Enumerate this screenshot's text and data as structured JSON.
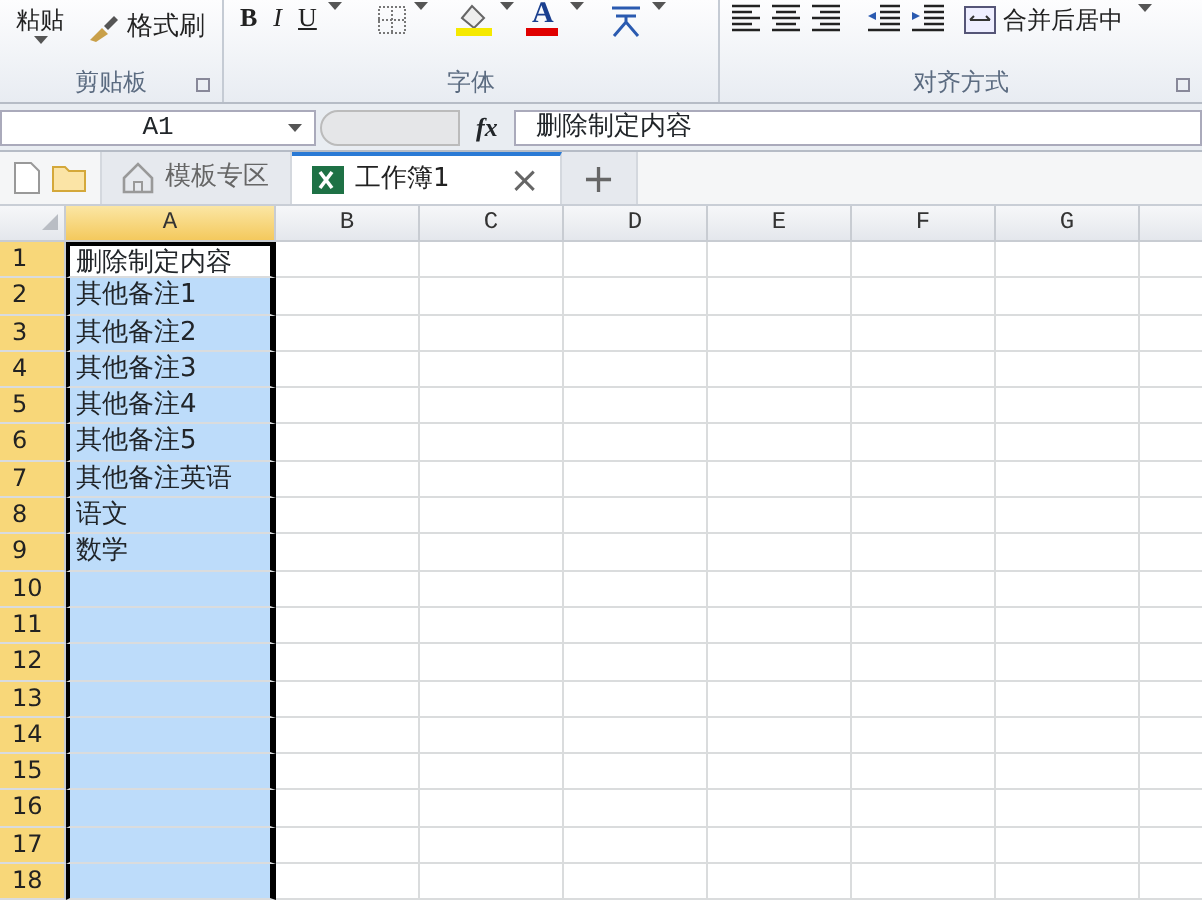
{
  "ribbon": {
    "groups": [
      {
        "kind": "clipboard",
        "label": "剪贴板",
        "paste": "粘贴",
        "format_painter": "格式刷"
      },
      {
        "kind": "font",
        "label": "字体",
        "bold": "B",
        "italic": "I",
        "underline": "U",
        "font_color": "A"
      },
      {
        "kind": "align",
        "label": "对齐方式",
        "merge": "合并后居中"
      }
    ]
  },
  "formula_bar": {
    "name_box": "A1",
    "fx": "fx",
    "value": "删除制定内容"
  },
  "tabs": [
    {
      "label": "模板专区",
      "selected": false,
      "kind": "template"
    },
    {
      "label": "工作簿1",
      "selected": true,
      "kind": "workbook",
      "close": "×"
    }
  ],
  "new_tab": "+",
  "sheet": {
    "columns": [
      {
        "label": "A",
        "selected": true
      },
      {
        "label": "B",
        "selected": false
      },
      {
        "label": "C",
        "selected": false
      },
      {
        "label": "D",
        "selected": false
      },
      {
        "label": "E",
        "selected": false
      },
      {
        "label": "F",
        "selected": false
      },
      {
        "label": "G",
        "selected": false
      }
    ],
    "rows": [
      {
        "number": "1",
        "selected": true,
        "active": true,
        "cells": [
          "删除制定内容"
        ]
      },
      {
        "number": "2",
        "selected": true,
        "cells": [
          "其他备注1"
        ]
      },
      {
        "number": "3",
        "selected": true,
        "cells": [
          "其他备注2"
        ]
      },
      {
        "number": "4",
        "selected": true,
        "cells": [
          "其他备注3"
        ]
      },
      {
        "number": "5",
        "selected": true,
        "cells": [
          "其他备注4"
        ]
      },
      {
        "number": "6",
        "selected": true,
        "cells": [
          "其他备注5"
        ]
      },
      {
        "number": "7",
        "selected": true,
        "cells": [
          "其他备注英语"
        ]
      },
      {
        "number": "8",
        "selected": true,
        "cells": [
          "语文"
        ]
      },
      {
        "number": "9",
        "selected": true,
        "cells": [
          "数学"
        ]
      },
      {
        "number": "10",
        "selected": true
      },
      {
        "number": "11",
        "selected": true
      },
      {
        "number": "12",
        "selected": true
      },
      {
        "number": "13",
        "selected": true
      },
      {
        "number": "14",
        "selected": true
      },
      {
        "number": "15",
        "selected": true
      },
      {
        "number": "16",
        "selected": true
      },
      {
        "number": "17",
        "selected": true
      },
      {
        "number": "18",
        "selected": true
      }
    ]
  }
}
